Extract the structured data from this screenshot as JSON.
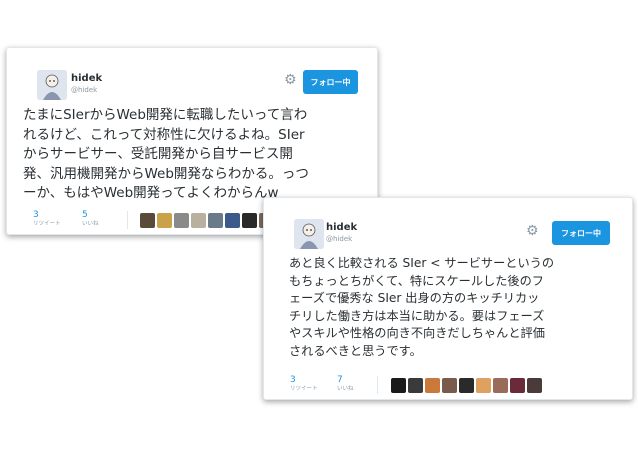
{
  "tweets": [
    {
      "name": "hidek",
      "handle": "@hidek",
      "follow_label": "フォロー中",
      "text": "たまにSIerからWeb開発に転職したいって言わ\nれるけど、これって対称性に欠けるよね。SIer\nからサービサー、受託開発から自サービス開\n発、汎用機開発からWeb開発ならわかる。っつ\nーか、もはやWeb開発ってよくわからんw",
      "retweets": "3",
      "retweets_label": "リツイート",
      "likes": "5",
      "likes_label": "いいね",
      "liker_colors": [
        "#5a4a3a",
        "#c9a24a",
        "#8a8a8a",
        "#b9b0a0",
        "#6a7a8a",
        "#3b5a8a",
        "#2a2a2a",
        "#7a6a5a"
      ]
    },
    {
      "name": "hidek",
      "handle": "@hidek",
      "follow_label": "フォロー中",
      "text": "あと良く比較される SIer < サービサーというの\nもちょっとちがくて、特にスケールした後のフ\nェーズで優秀な SIer 出身の方のキッチリカッ\nチリした働き方は本当に助かる。要はフェーズ\nやスキルや性格の向き不向きだしちゃんと評価\nされるべきと思うです。",
      "retweets": "3",
      "retweets_label": "リツイート",
      "likes": "7",
      "likes_label": "いいね",
      "liker_colors": [
        "#1a1a1a",
        "#3a3a3a",
        "#c97a3a",
        "#7a5a4a",
        "#2a2a2a",
        "#e0a060",
        "#9a6a5a",
        "#6a2a3a",
        "#4a3a3a"
      ]
    }
  ]
}
